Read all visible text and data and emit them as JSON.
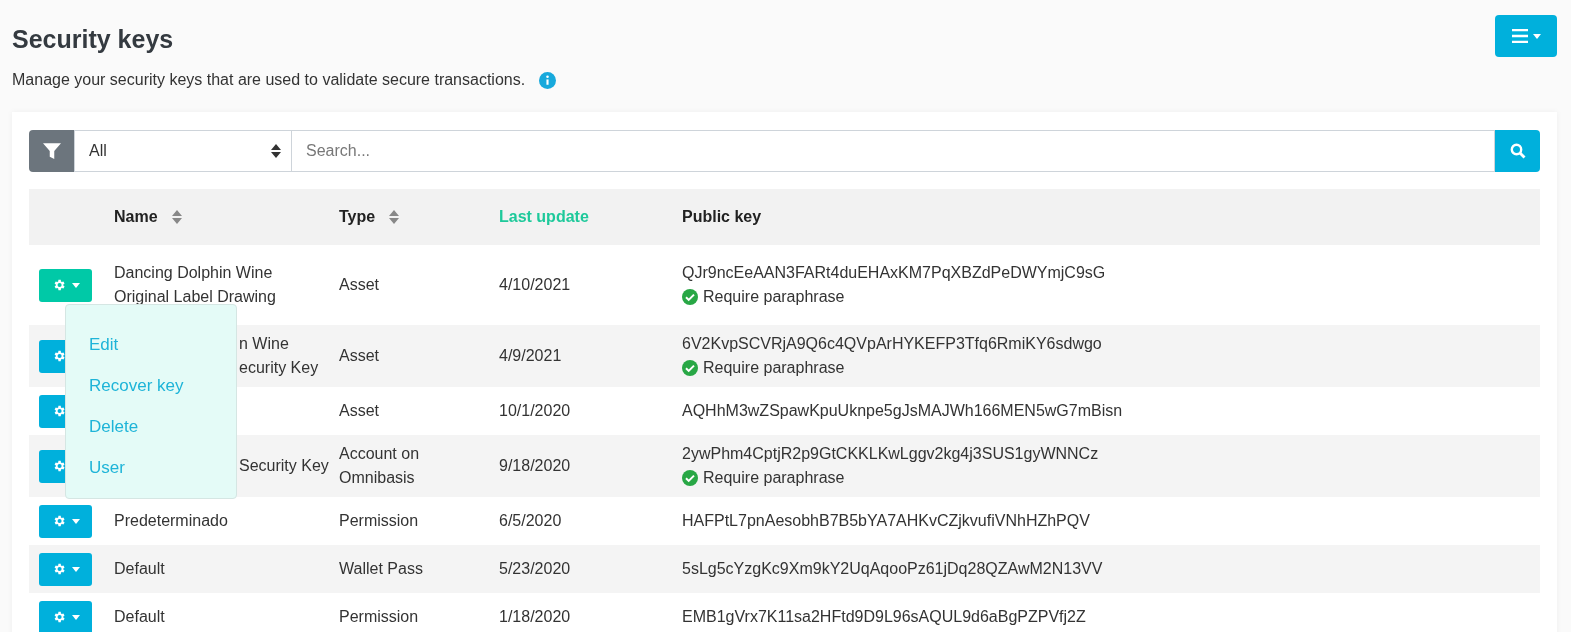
{
  "title": "Security keys",
  "subtitle": "Manage your security keys that are used to validate secure transactions.",
  "filter": {
    "value": "All",
    "placeholder": "Search..."
  },
  "columns": [
    {
      "label": "Name",
      "sortable": true,
      "sorted": false
    },
    {
      "label": "Type",
      "sortable": true,
      "sorted": false
    },
    {
      "label": "Last update",
      "sortable": false,
      "sorted": true
    },
    {
      "label": "Public key",
      "sortable": false,
      "sorted": false
    }
  ],
  "rows": [
    {
      "selected": true,
      "name_lines": [
        "Dancing Dolphin Wine",
        "Original Label Drawing"
      ],
      "type_lines": [
        "Asset"
      ],
      "date": "4/10/2021",
      "key": "QJr9ncEeAAN3FARt4duEHAxKM7PqXBZdPeDWYmjC9sG",
      "note": "Require paraphrase"
    },
    {
      "selected": false,
      "name_lines": [
        "n Wine",
        "ecurity Key"
      ],
      "type_lines": [
        "Asset"
      ],
      "date": "4/9/2021",
      "key": "6V2KvpSCVRjA9Q6c4QVpArHYKEFP3Tfq6RmiKY6sdwgo",
      "note": "Require paraphrase"
    },
    {
      "selected": false,
      "type_lines": [
        "Asset"
      ],
      "date": "10/1/2020",
      "key": "AQHhM3wZSpawKpuUknpe5gJsMAJWh166MEN5wG7mBisn"
    },
    {
      "selected": false,
      "name_lines": [
        "Security Key"
      ],
      "type_lines": [
        "Account on",
        "Omnibasis"
      ],
      "date": "9/18/2020",
      "key": "2ywPhm4CptjR2p9GtCKKLKwLggv2kg4j3SUS1gyWNNCz",
      "note": "Require paraphrase"
    },
    {
      "selected": false,
      "name_lines": [
        "Predeterminado"
      ],
      "type_lines": [
        "Permission"
      ],
      "date": "6/5/2020",
      "key": "HAFPtL7pnAesobhB7B5bYA7AHKvCZjkvufiVNhHZhPQV"
    },
    {
      "selected": false,
      "name_lines": [
        "Default"
      ],
      "type_lines": [
        "Wallet Pass"
      ],
      "date": "5/23/2020",
      "key": "5sLg5cYzgKc9Xm9kY2UqAqooPz61jDq28QZAwM2N13VV"
    },
    {
      "selected": false,
      "name_lines": [
        "Default"
      ],
      "type_lines": [
        "Permission"
      ],
      "date": "1/18/2020",
      "key": "EMB1gVrx7K11sa2HFtd9D9L96sAQUL9d6aBgPZPVfj2Z"
    }
  ],
  "menu": [
    "Edit",
    "Recover key",
    "Delete",
    "User"
  ]
}
